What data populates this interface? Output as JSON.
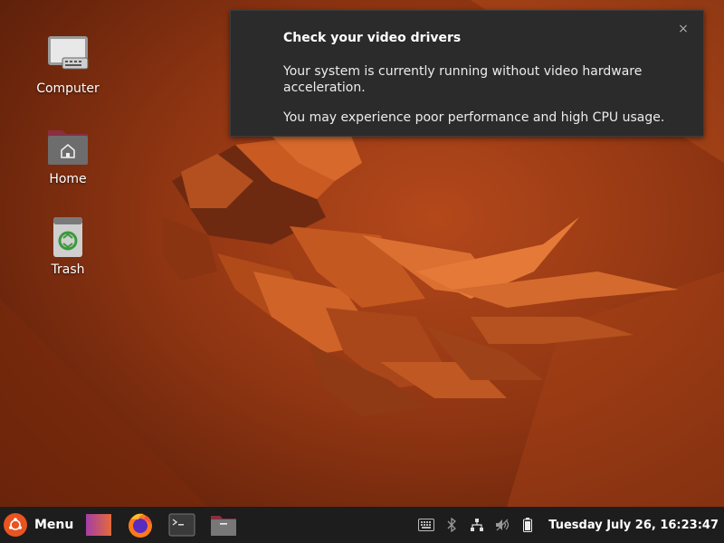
{
  "desktop": {
    "icons": [
      {
        "label": "Computer"
      },
      {
        "label": "Home"
      },
      {
        "label": "Trash"
      }
    ]
  },
  "notification": {
    "title": "Check your video drivers",
    "body": "Your system is currently running without video hardware acceleration.",
    "body2": "You may experience poor performance and high CPU usage.",
    "close_label": "×"
  },
  "panel": {
    "menu_label": "Menu",
    "clock": "Tuesday July 26, 16:23:47",
    "launchers": [
      "workspace-switcher-icon",
      "firefox-icon",
      "terminal-icon",
      "file-manager-icon"
    ],
    "tray_icons": [
      "keyboard-icon",
      "bluetooth-icon",
      "network-icon",
      "volume-muted-icon",
      "battery-icon"
    ]
  },
  "colors": {
    "accent": "#e95420",
    "panel_bg": "#1d1d1d",
    "notification_bg": "#2b2b2b"
  }
}
